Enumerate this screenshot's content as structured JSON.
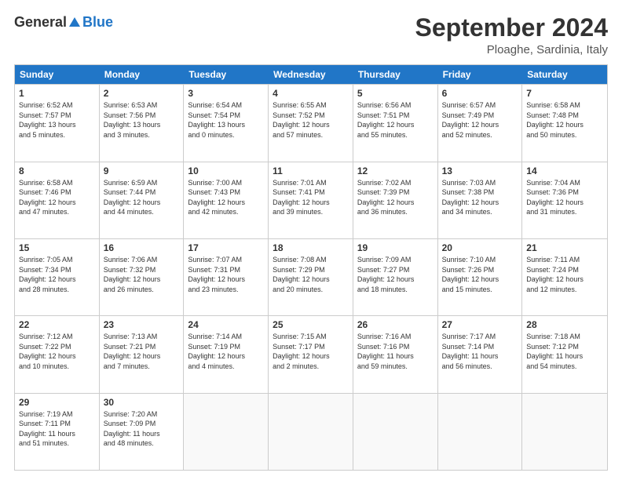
{
  "logo": {
    "general": "General",
    "blue": "Blue"
  },
  "title": "September 2024",
  "location": "Ploaghe, Sardinia, Italy",
  "days_of_week": [
    "Sunday",
    "Monday",
    "Tuesday",
    "Wednesday",
    "Thursday",
    "Friday",
    "Saturday"
  ],
  "weeks": [
    [
      {
        "day": "1",
        "info": "Sunrise: 6:52 AM\nSunset: 7:57 PM\nDaylight: 13 hours\nand 5 minutes."
      },
      {
        "day": "2",
        "info": "Sunrise: 6:53 AM\nSunset: 7:56 PM\nDaylight: 13 hours\nand 3 minutes."
      },
      {
        "day": "3",
        "info": "Sunrise: 6:54 AM\nSunset: 7:54 PM\nDaylight: 13 hours\nand 0 minutes."
      },
      {
        "day": "4",
        "info": "Sunrise: 6:55 AM\nSunset: 7:52 PM\nDaylight: 12 hours\nand 57 minutes."
      },
      {
        "day": "5",
        "info": "Sunrise: 6:56 AM\nSunset: 7:51 PM\nDaylight: 12 hours\nand 55 minutes."
      },
      {
        "day": "6",
        "info": "Sunrise: 6:57 AM\nSunset: 7:49 PM\nDaylight: 12 hours\nand 52 minutes."
      },
      {
        "day": "7",
        "info": "Sunrise: 6:58 AM\nSunset: 7:48 PM\nDaylight: 12 hours\nand 50 minutes."
      }
    ],
    [
      {
        "day": "8",
        "info": "Sunrise: 6:58 AM\nSunset: 7:46 PM\nDaylight: 12 hours\nand 47 minutes."
      },
      {
        "day": "9",
        "info": "Sunrise: 6:59 AM\nSunset: 7:44 PM\nDaylight: 12 hours\nand 44 minutes."
      },
      {
        "day": "10",
        "info": "Sunrise: 7:00 AM\nSunset: 7:43 PM\nDaylight: 12 hours\nand 42 minutes."
      },
      {
        "day": "11",
        "info": "Sunrise: 7:01 AM\nSunset: 7:41 PM\nDaylight: 12 hours\nand 39 minutes."
      },
      {
        "day": "12",
        "info": "Sunrise: 7:02 AM\nSunset: 7:39 PM\nDaylight: 12 hours\nand 36 minutes."
      },
      {
        "day": "13",
        "info": "Sunrise: 7:03 AM\nSunset: 7:38 PM\nDaylight: 12 hours\nand 34 minutes."
      },
      {
        "day": "14",
        "info": "Sunrise: 7:04 AM\nSunset: 7:36 PM\nDaylight: 12 hours\nand 31 minutes."
      }
    ],
    [
      {
        "day": "15",
        "info": "Sunrise: 7:05 AM\nSunset: 7:34 PM\nDaylight: 12 hours\nand 28 minutes."
      },
      {
        "day": "16",
        "info": "Sunrise: 7:06 AM\nSunset: 7:32 PM\nDaylight: 12 hours\nand 26 minutes."
      },
      {
        "day": "17",
        "info": "Sunrise: 7:07 AM\nSunset: 7:31 PM\nDaylight: 12 hours\nand 23 minutes."
      },
      {
        "day": "18",
        "info": "Sunrise: 7:08 AM\nSunset: 7:29 PM\nDaylight: 12 hours\nand 20 minutes."
      },
      {
        "day": "19",
        "info": "Sunrise: 7:09 AM\nSunset: 7:27 PM\nDaylight: 12 hours\nand 18 minutes."
      },
      {
        "day": "20",
        "info": "Sunrise: 7:10 AM\nSunset: 7:26 PM\nDaylight: 12 hours\nand 15 minutes."
      },
      {
        "day": "21",
        "info": "Sunrise: 7:11 AM\nSunset: 7:24 PM\nDaylight: 12 hours\nand 12 minutes."
      }
    ],
    [
      {
        "day": "22",
        "info": "Sunrise: 7:12 AM\nSunset: 7:22 PM\nDaylight: 12 hours\nand 10 minutes."
      },
      {
        "day": "23",
        "info": "Sunrise: 7:13 AM\nSunset: 7:21 PM\nDaylight: 12 hours\nand 7 minutes."
      },
      {
        "day": "24",
        "info": "Sunrise: 7:14 AM\nSunset: 7:19 PM\nDaylight: 12 hours\nand 4 minutes."
      },
      {
        "day": "25",
        "info": "Sunrise: 7:15 AM\nSunset: 7:17 PM\nDaylight: 12 hours\nand 2 minutes."
      },
      {
        "day": "26",
        "info": "Sunrise: 7:16 AM\nSunset: 7:16 PM\nDaylight: 11 hours\nand 59 minutes."
      },
      {
        "day": "27",
        "info": "Sunrise: 7:17 AM\nSunset: 7:14 PM\nDaylight: 11 hours\nand 56 minutes."
      },
      {
        "day": "28",
        "info": "Sunrise: 7:18 AM\nSunset: 7:12 PM\nDaylight: 11 hours\nand 54 minutes."
      }
    ],
    [
      {
        "day": "29",
        "info": "Sunrise: 7:19 AM\nSunset: 7:11 PM\nDaylight: 11 hours\nand 51 minutes."
      },
      {
        "day": "30",
        "info": "Sunrise: 7:20 AM\nSunset: 7:09 PM\nDaylight: 11 hours\nand 48 minutes."
      },
      {
        "day": "",
        "info": ""
      },
      {
        "day": "",
        "info": ""
      },
      {
        "day": "",
        "info": ""
      },
      {
        "day": "",
        "info": ""
      },
      {
        "day": "",
        "info": ""
      }
    ]
  ]
}
